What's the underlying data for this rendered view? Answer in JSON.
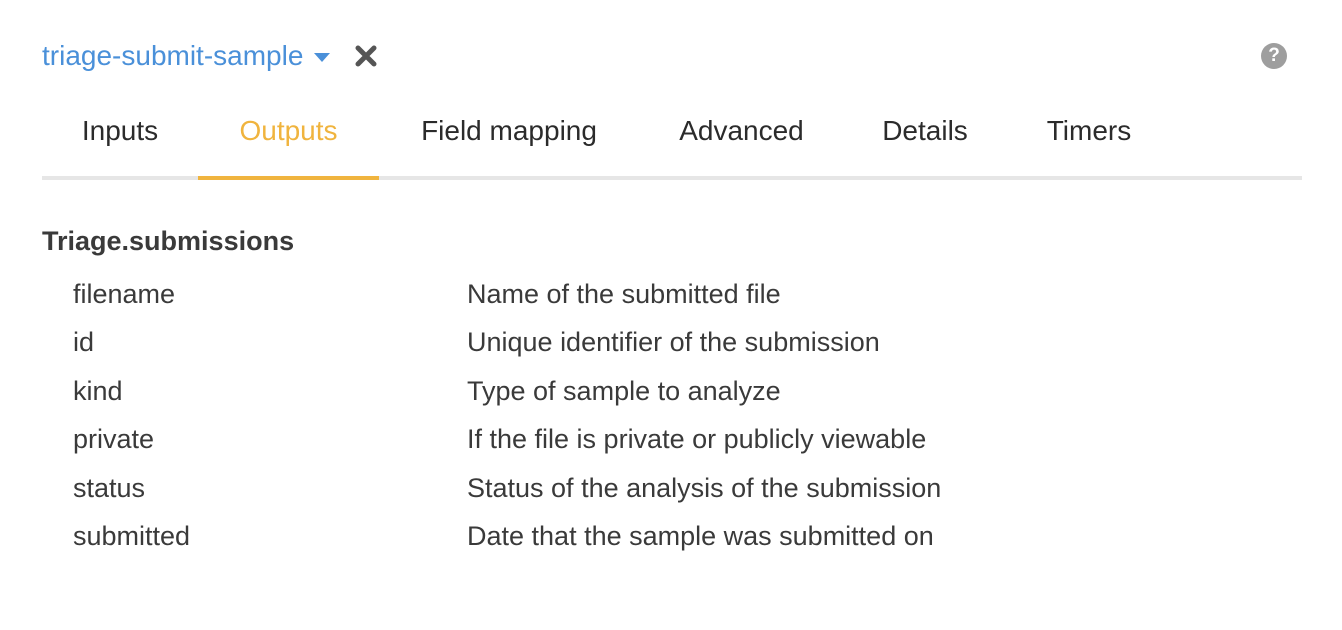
{
  "header": {
    "action_name": "triage-submit-sample",
    "icons": {
      "dropdown": "caret-down-icon",
      "close": "close-icon",
      "help": "help-icon"
    },
    "help_glyph": "?"
  },
  "tabs": [
    {
      "label": "Inputs",
      "active": false
    },
    {
      "label": "Outputs",
      "active": true
    },
    {
      "label": "Field mapping",
      "active": false
    },
    {
      "label": "Advanced",
      "active": false
    },
    {
      "label": "Details",
      "active": false
    },
    {
      "label": "Timers",
      "active": false
    }
  ],
  "colors": {
    "link": "#4a90d9",
    "active_tab": "#f0b43e",
    "tab_border": "#e6e6e6",
    "help_icon": "#9e9e9e"
  },
  "outputs": {
    "title": "Triage.submissions",
    "fields": [
      {
        "name": "filename",
        "description": "Name of the submitted file"
      },
      {
        "name": "id",
        "description": "Unique identifier of the submission"
      },
      {
        "name": "kind",
        "description": "Type of sample to analyze"
      },
      {
        "name": "private",
        "description": "If the file is private or publicly viewable"
      },
      {
        "name": "status",
        "description": "Status of the analysis of the submission"
      },
      {
        "name": "submitted",
        "description": "Date that the sample was submitted on"
      }
    ]
  }
}
